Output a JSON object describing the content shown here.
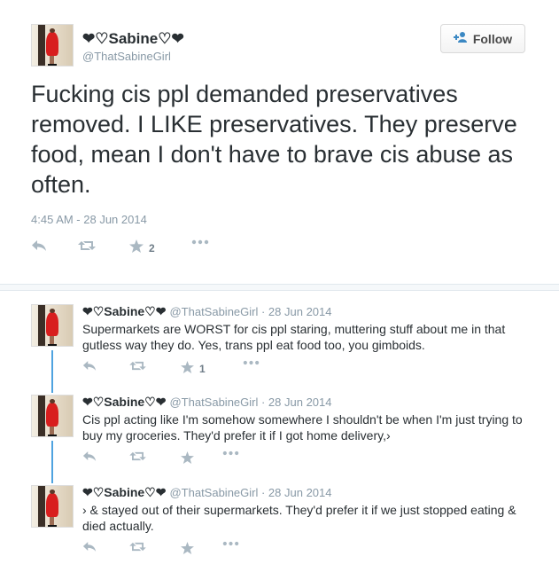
{
  "main_tweet": {
    "name": "❤♡Sabine♡❤",
    "handle": "@ThatSabineGirl",
    "follow_label": "Follow",
    "text": "Fucking cis ppl demanded preservatives removed. I LIKE preservatives. They preserve food, mean I don't have to brave cis abuse as often.",
    "timestamp": "4:45 AM - 28 Jun 2014",
    "favorites": "2"
  },
  "replies": [
    {
      "name": "❤♡Sabine♡❤",
      "meta": "@ThatSabineGirl · 28 Jun 2014",
      "text": "Supermarkets are WORST for cis ppl staring, muttering stuff about me in that gutless way they do. Yes, trans ppl eat food too, you gimboids.",
      "favorites": "1"
    },
    {
      "name": "❤♡Sabine♡❤",
      "meta": "@ThatSabineGirl · 28 Jun 2014",
      "text": "Cis ppl acting like I'm somehow somewhere I shouldn't be when I'm just trying to buy my groceries. They'd prefer it if I got home delivery,›",
      "favorites": ""
    },
    {
      "name": "❤♡Sabine♡❤",
      "meta": "@ThatSabineGirl · 28 Jun 2014",
      "text": "› & stayed out of their supermarkets. They'd prefer it if we just stopped eating & died actually.",
      "favorites": ""
    }
  ],
  "icons": {
    "reply": "↩",
    "retweet": "⇄",
    "favorite": "★",
    "more": "•••",
    "follow": "+👤"
  },
  "colors": {
    "accent": "#3b88c3",
    "thread_line": "#4fa3e0",
    "meta_text": "#8899a6",
    "action_icon": "#aab8c2"
  }
}
